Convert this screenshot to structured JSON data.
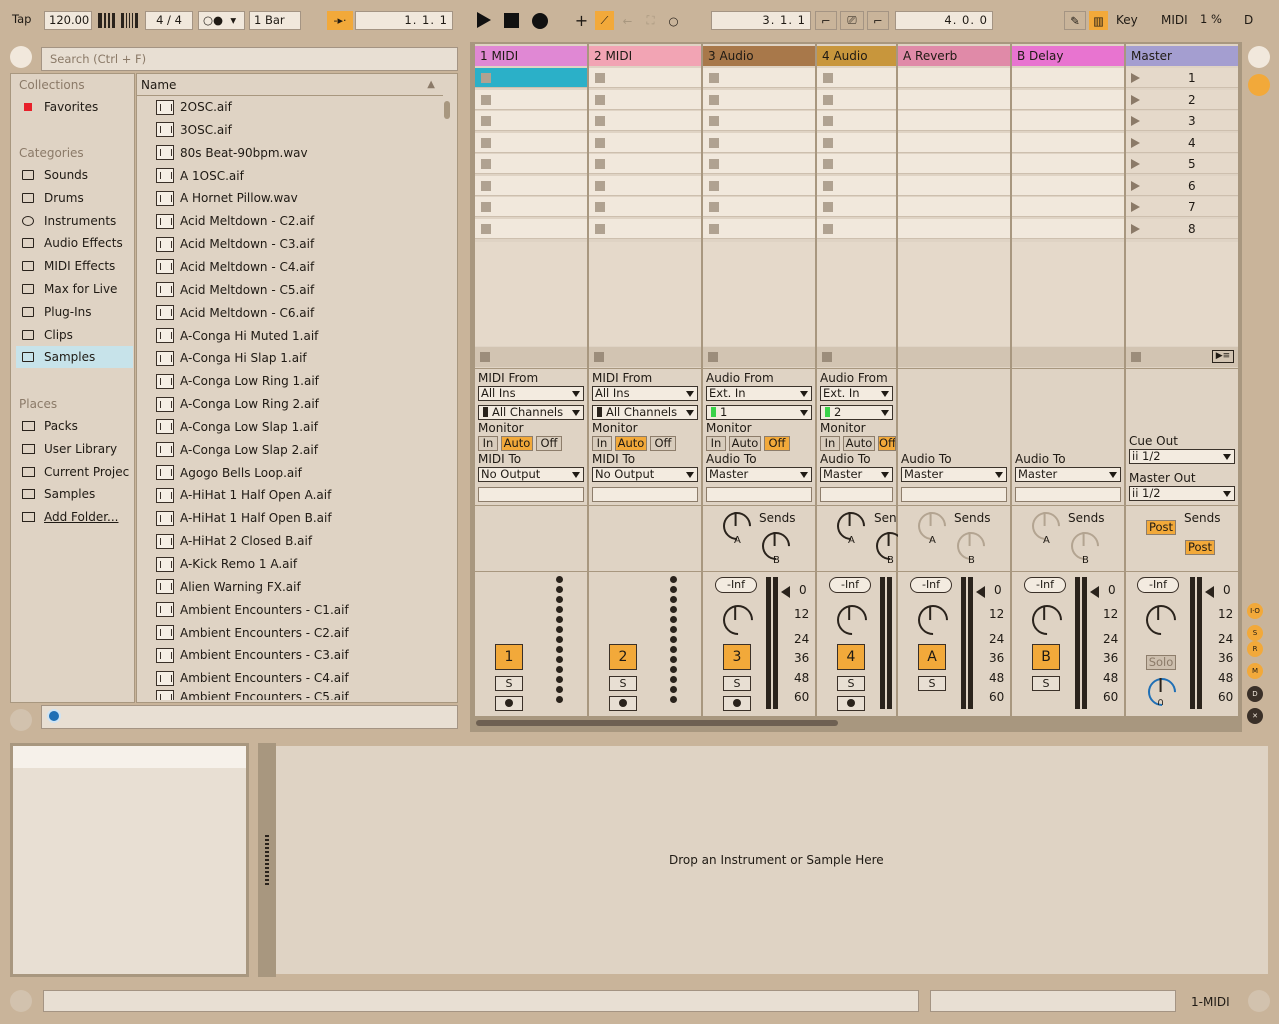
{
  "transport": {
    "tap": "Tap",
    "tempo": "120.00",
    "sig": "4 / 4",
    "quant": "1 Bar",
    "arr_pos": "1.   1.   1",
    "loop_start": "3.   1.   1",
    "loop_len": "4.   0.   0",
    "key": "Key",
    "midi": "MIDI",
    "cpu": "1 %",
    "d": "D"
  },
  "browser": {
    "search_placeholder": "Search (Ctrl + F)",
    "collections_h": "Collections",
    "favorites": "Favorites",
    "categories_h": "Categories",
    "places_h": "Places",
    "name_col": "Name",
    "categories": [
      "Sounds",
      "Drums",
      "Instruments",
      "Audio Effects",
      "MIDI Effects",
      "Max for Live",
      "Plug-Ins",
      "Clips",
      "Samples"
    ],
    "places": [
      "Packs",
      "User Library",
      "Current Projec",
      "Samples",
      "Add Folder..."
    ],
    "files": [
      "2OSC.aif",
      "3OSC.aif",
      "80s Beat-90bpm.wav",
      "A 1OSC.aif",
      "A Hornet Pillow.wav",
      "Acid Meltdown - C2.aif",
      "Acid Meltdown - C3.aif",
      "Acid Meltdown - C4.aif",
      "Acid Meltdown - C5.aif",
      "Acid Meltdown - C6.aif",
      "A-Conga Hi Muted 1.aif",
      "A-Conga Hi Slap 1.aif",
      "A-Conga Low Ring 1.aif",
      "A-Conga Low Ring 2.aif",
      "A-Conga Low Slap 1.aif",
      "A-Conga Low Slap 2.aif",
      "Agogo Bells Loop.aif",
      "A-HiHat 1 Half Open A.aif",
      "A-HiHat 1 Half Open B.aif",
      "A-HiHat 2 Closed B.aif",
      "A-Kick Remo 1 A.aif",
      "Alien Warning FX.aif",
      "Ambient Encounters - C1.aif",
      "Ambient Encounters - C2.aif",
      "Ambient Encounters - C3.aif",
      "Ambient Encounters - C4.aif",
      "Ambient Encounters - C5.aif"
    ]
  },
  "tracks": [
    {
      "name": "1 MIDI",
      "color": "#e088d4",
      "num": "1",
      "from_l": "MIDI From",
      "from": "All Ins",
      "ch": "All Channels",
      "mon": "Monitor",
      "to_l": "MIDI To",
      "to": "No Output"
    },
    {
      "name": "2 MIDI",
      "color": "#f2a4b4",
      "num": "2",
      "from_l": "MIDI From",
      "from": "All Ins",
      "ch": "All Channels",
      "mon": "Monitor",
      "to_l": "MIDI To",
      "to": "No Output"
    },
    {
      "name": "3 Audio",
      "color": "#a8784a",
      "num": "3",
      "from_l": "Audio From",
      "from": "Ext. In",
      "ch": "1",
      "mon": "Monitor",
      "to_l": "Audio To",
      "to": "Master"
    },
    {
      "name": "4 Audio",
      "color": "#c8963c",
      "num": "4",
      "from_l": "Audio From",
      "from": "Ext. In",
      "ch": "2",
      "mon": "Monitor",
      "to_l": "Audio To",
      "to": "Master"
    },
    {
      "name": "A Reverb",
      "color": "#e08aa8",
      "num": "A",
      "to_l": "Audio To",
      "to": "Master"
    },
    {
      "name": "B Delay",
      "color": "#e874d0",
      "num": "B",
      "to_l": "Audio To",
      "to": "Master"
    },
    {
      "name": "Master",
      "color": "#a49ed0"
    }
  ],
  "mon": {
    "in": "In",
    "auto": "Auto",
    "off": "Off"
  },
  "sends": "Sends",
  "solo_s": "S",
  "inf": "-Inf",
  "solo": "Solo",
  "post": "Post",
  "cue_out": "Cue Out",
  "cue_val": "ii 1/2",
  "master_out": "Master Out",
  "master_val": "ii 1/2",
  "scenes": [
    "1",
    "2",
    "3",
    "4",
    "5",
    "6",
    "7",
    "8"
  ],
  "scale": [
    "0",
    "12",
    "24",
    "36",
    "48",
    "60"
  ],
  "drop": "Drop an Instrument or Sample Here",
  "status_track": "1-MIDI"
}
